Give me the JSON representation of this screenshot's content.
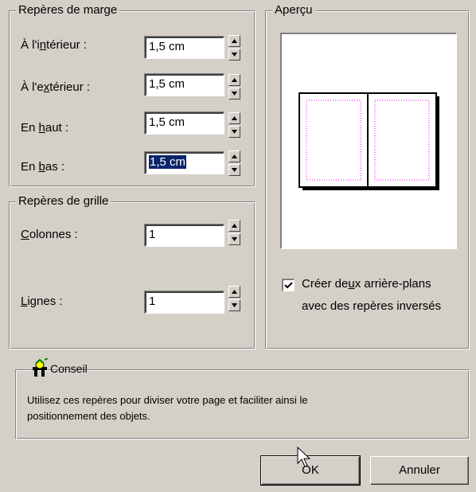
{
  "margins": {
    "title": "Repères de marge",
    "inside": {
      "label_pre": "À l'i",
      "label_u": "n",
      "label_post": "térieur :",
      "value": "1,5 cm"
    },
    "outside": {
      "label_pre": "À l'e",
      "label_u": "x",
      "label_post": "térieur :",
      "value": "1,5 cm"
    },
    "top": {
      "label_pre": "En ",
      "label_u": "h",
      "label_post": "aut :",
      "value": "1,5 cm"
    },
    "bottom": {
      "label_pre": "En ",
      "label_u": "b",
      "label_post": "as :",
      "value": "1,5 cm"
    }
  },
  "grid": {
    "title": "Repères de grille",
    "columns": {
      "label_pre": "",
      "label_u": "C",
      "label_post": "olonnes :",
      "value": "1"
    },
    "rows": {
      "label_pre": "",
      "label_u": "L",
      "label_post": "ignes :",
      "value": "1"
    }
  },
  "preview": {
    "title": "Aperçu",
    "checkbox_checked": true,
    "checkbox_line1_pre": "Créer de",
    "checkbox_line1_u": "u",
    "checkbox_line1_post": "x arrière-plans",
    "checkbox_line2": "avec des repères inversés"
  },
  "tip": {
    "title": "Conseil",
    "text_line1": "Utilisez ces repères pour diviser votre page et faciliter ainsi le",
    "text_line2": "positionnement des objets."
  },
  "buttons": {
    "ok": "OK",
    "cancel": "Annuler"
  },
  "colors": {
    "dialog_bg": "#d4d0c8",
    "selection": "#0a246a",
    "guide_pink": "#ff00ff"
  }
}
